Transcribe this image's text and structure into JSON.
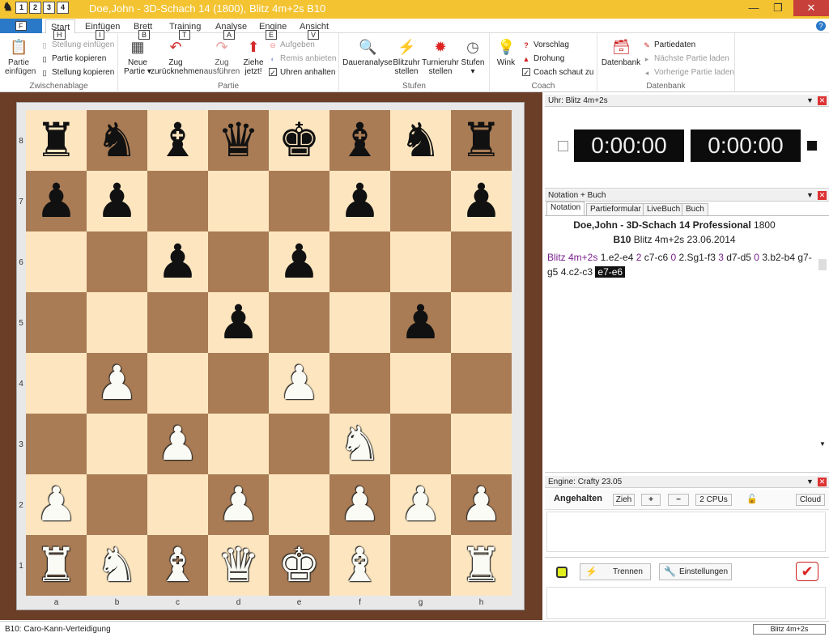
{
  "window": {
    "title": "Doe,John - 3D-Schach 14 (1800), Blitz 4m+2s  B10",
    "qat_keys": [
      "1",
      "2",
      "3",
      "4"
    ],
    "controls": {
      "minimize": "—",
      "restore": "❐",
      "close": "✕"
    },
    "help": "?"
  },
  "menu": {
    "file_key": "F",
    "tabs": [
      {
        "label": "Start",
        "key": "H"
      },
      {
        "label": "Einfügen",
        "key": "I"
      },
      {
        "label": "Brett",
        "key": "B"
      },
      {
        "label": "Training",
        "key": "T"
      },
      {
        "label": "Analyse",
        "key": "A"
      },
      {
        "label": "Engine",
        "key": "E"
      },
      {
        "label": "Ansicht",
        "key": "V"
      }
    ]
  },
  "ribbon": {
    "zwischenablage": {
      "label": "Zwischenablage",
      "partie_einfuegen": "Partie\neinfügen",
      "stellung_einfuegen": "Stellung einfügen",
      "partie_kopieren": "Partie kopieren",
      "stellung_kopieren": "Stellung kopieren"
    },
    "partie": {
      "label": "Partie",
      "neue_partie": "Neue\nPartie ▾",
      "zug_zurueck": "Zug\nzurücknehmen",
      "zug_ausfuehren": "Zug\nausführen",
      "ziehe_jetzt": "Ziehe\njetzt!",
      "aufgeben": "Aufgeben",
      "remis_anbieten": "Remis anbieten",
      "uhren_anhalten": "Uhren anhalten"
    },
    "stufen": {
      "label": "Stufen",
      "daueranalyse": "Daueranalyse",
      "blitzuhr": "Blitzuhr\nstellen",
      "turnieruhr": "Turnieruhr\nstellen",
      "stufen": "Stufen\n▾"
    },
    "coach": {
      "label": "Coach",
      "wink": "Wink",
      "vorschlag": "Vorschlag",
      "drohung": "Drohung",
      "coach_schaut_zu": "Coach schaut zu"
    },
    "datenbank": {
      "label": "Datenbank",
      "datenbank": "Datenbank",
      "partiedaten": "Partiedaten",
      "naechste_partie": "Nächste Partie laden",
      "vorherige_partie": "Vorherige Partie laden"
    }
  },
  "board": {
    "ranks": [
      "8",
      "7",
      "6",
      "5",
      "4",
      "3",
      "2",
      "1"
    ],
    "files": [
      "a",
      "b",
      "c",
      "d",
      "e",
      "f",
      "g",
      "h"
    ],
    "rows": [
      [
        "r",
        "n",
        "b",
        "q",
        "k",
        "b",
        "n",
        "r"
      ],
      [
        "p",
        "p",
        "",
        "",
        "",
        "p",
        "",
        "p"
      ],
      [
        "",
        "",
        "p",
        "",
        "p",
        "",
        "",
        ""
      ],
      [
        "",
        "",
        "",
        "p",
        "",
        "",
        "p",
        ""
      ],
      [
        "",
        "P",
        "",
        "",
        "P",
        "",
        "",
        ""
      ],
      [
        "",
        "",
        "P",
        "",
        "",
        "N",
        "",
        ""
      ],
      [
        "P",
        "",
        "",
        "P",
        "",
        "P",
        "P",
        "P"
      ],
      [
        "R",
        "N",
        "B",
        "Q",
        "K",
        "B",
        "",
        "R"
      ]
    ]
  },
  "clock_pane": {
    "title": "Uhr: Blitz 4m+2s",
    "white_time": "0:00:00",
    "black_time": "0:00:00"
  },
  "notation_pane": {
    "title": "Notation + Buch",
    "tabs": [
      "Notation",
      "Partieformular",
      "LiveBuch",
      "Buch"
    ],
    "header_line1_bold": "Doe,John - 3D-Schach 14 Professional",
    "header_line1_elo": "1800",
    "header_line2_bold": "B10",
    "header_line2_rest": "Blitz 4m+2s 23.06.2014",
    "moves": [
      {
        "text": "Blitz 4m+2s",
        "type": "num"
      },
      {
        "text": "1.e2-e4",
        "type": "mv"
      },
      {
        "text": "2",
        "type": "num"
      },
      {
        "text": "c7-c6",
        "type": "mv"
      },
      {
        "text": "0",
        "type": "num"
      },
      {
        "text": "2.Sg1-f3",
        "type": "mv"
      },
      {
        "text": "3",
        "type": "num"
      },
      {
        "text": "d7-d5",
        "type": "mv"
      },
      {
        "text": "0",
        "type": "num"
      },
      {
        "text": "3.b2-b4",
        "type": "mv"
      },
      {
        "text": "g7-g5",
        "type": "mv"
      },
      {
        "text": "4.c2-c3",
        "type": "mv"
      },
      {
        "text": "e7-e6",
        "type": "cur"
      }
    ]
  },
  "engine_pane": {
    "title": "Engine: Crafty 23.05",
    "angehalten": "Angehalten",
    "zieh": "Zieh",
    "plus": "+",
    "minus": "−",
    "cpus": "2 CPUs",
    "cloud": "Cloud",
    "trennen": "Trennen",
    "einstellungen": "Einstellungen"
  },
  "status": {
    "opening": "B10: Caro-Kann-Verteidigung",
    "timecontrol": "Blitz 4m+2s"
  }
}
